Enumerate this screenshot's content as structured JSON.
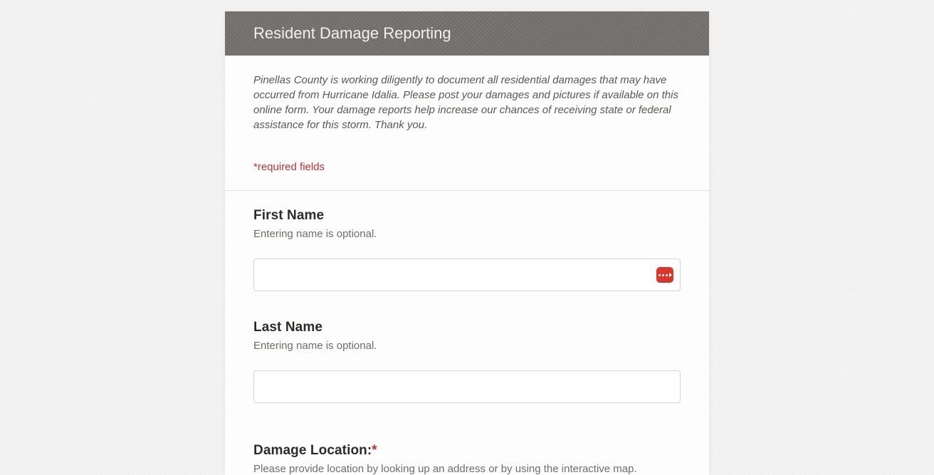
{
  "header": {
    "title": "Resident Damage Reporting"
  },
  "intro": {
    "text": "Pinellas County is working diligently to document all residential damages that may have occurred from Hurricane Idalia. Please post your damages and pictures if available on this online form. Your damage reports help increase our chances of receiving state or federal assistance for this storm. Thank you.",
    "required_note": "*required fields"
  },
  "fields": {
    "first_name": {
      "label": "First Name",
      "help": "Entering name is optional.",
      "value": ""
    },
    "last_name": {
      "label": "Last Name",
      "help": "Entering name is optional.",
      "value": ""
    },
    "damage_location": {
      "label": "Damage Location:",
      "required_marker": "*",
      "help": "Please provide location by looking up an address or by using the interactive map."
    }
  }
}
